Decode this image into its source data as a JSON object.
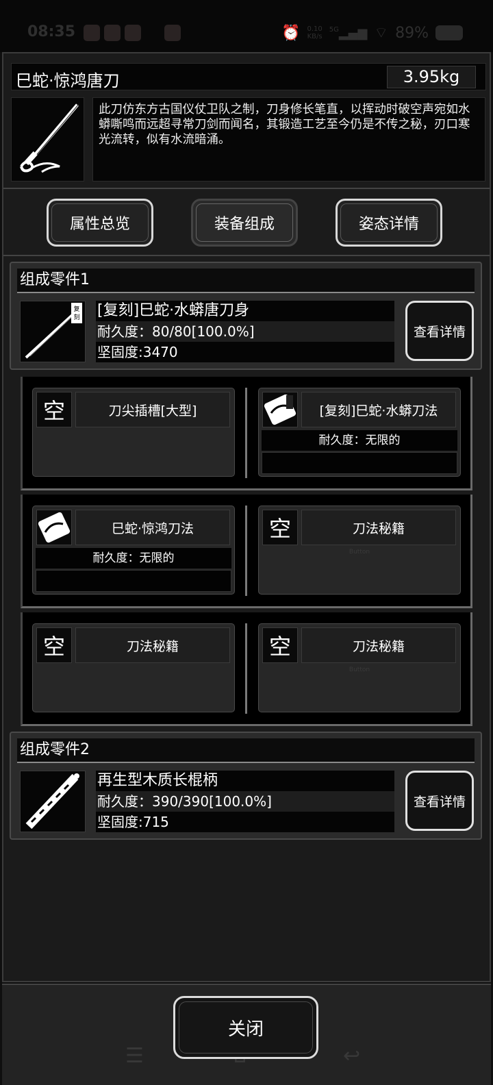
{
  "statusbar": {
    "time": "08:35",
    "net_speed_value": "0.10",
    "net_speed_unit": "KB/s",
    "signal": "5G",
    "battery": "89%"
  },
  "item": {
    "name": "巳蛇·惊鸿唐刀",
    "weight": "3.95kg",
    "description": "此刀仿东方古国仪仗卫队之制，刀身修长笔直，以挥动时破空声宛如水蟒嘶鸣而远超寻常刀剑而闻名，其锻造工艺至今仍是不传之秘，刃口寒光流转，似有水流暗涌。"
  },
  "tabs": [
    {
      "label": "属性总览"
    },
    {
      "label": "装备组成"
    },
    {
      "label": "姿态详情"
    }
  ],
  "parts": [
    {
      "header": "组成零件1",
      "name": "[复刻]巳蛇·水蟒唐刀身",
      "durability": "耐久度：80/80[100.0%]",
      "hardness": "坚固度:3470",
      "detail_label": "查看详情",
      "badge": "复刻"
    },
    {
      "header": "组成零件2",
      "name": "再生型木质长棍柄",
      "durability": "耐久度：390/390[100.0%]",
      "hardness": "坚固度:715",
      "detail_label": "查看详情"
    }
  ],
  "slots": {
    "empty_glyph": "空",
    "ghost": "Button",
    "r1_left": {
      "name": "刀尖插槽[大型]"
    },
    "r1_right": {
      "name": "[复刻]巳蛇·水蟒刀法",
      "durability": "耐久度：无限的"
    },
    "r2_left": {
      "name": "巳蛇·惊鸿刀法",
      "durability": "耐久度：无限的"
    },
    "r2_right": {
      "name": "刀法秘籍"
    },
    "r3_left": {
      "name": "刀法秘籍"
    },
    "r3_right": {
      "name": "刀法秘籍"
    }
  },
  "close_label": "关闭"
}
